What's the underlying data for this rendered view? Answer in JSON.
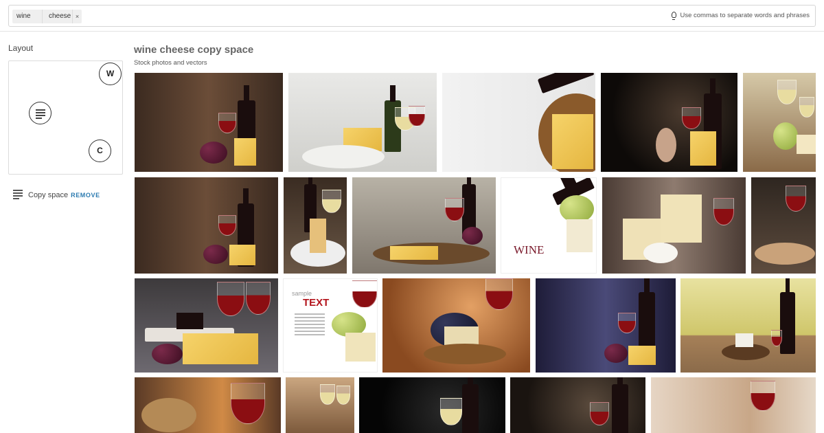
{
  "search": {
    "tags": [
      {
        "label": "wine",
        "remove": "×"
      },
      {
        "label": "cheese",
        "remove": "×"
      }
    ],
    "hint_icon": "lightbulb-icon",
    "hint": "Use commas to separate words and phrases"
  },
  "sidebar": {
    "layout_title": "Layout",
    "markers": {
      "w": "W",
      "c": "C",
      "text_icon": "text-lines-icon"
    },
    "copy_space_label": "Copy space",
    "remove_label": "REMOVE"
  },
  "results": {
    "title": "wine cheese copy space",
    "subtitle": "Stock photos and vectors"
  },
  "photo_text": {
    "wine_tile": "WINE",
    "sample": "sample",
    "text": "TEXT"
  },
  "colors": {
    "accent_link": "#2a7ab0",
    "wine_red": "#8b0e12",
    "cheese_yellow": "#f6d36a"
  }
}
